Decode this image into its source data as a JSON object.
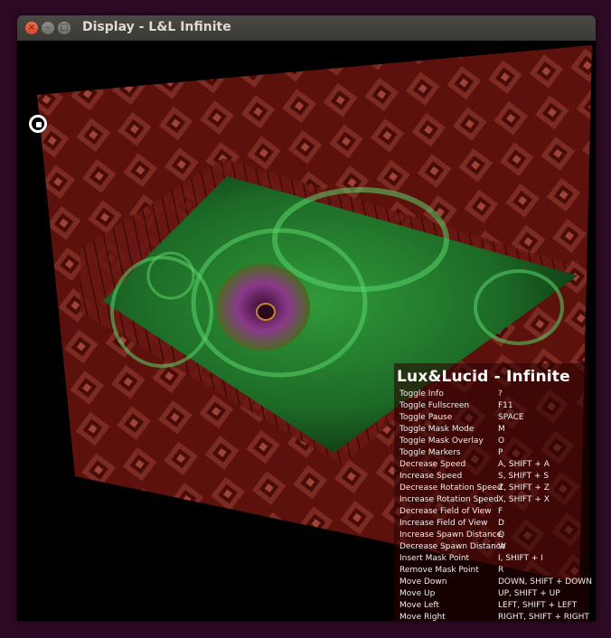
{
  "window": {
    "title": "Display - L&L Infinite",
    "close_label": "×",
    "minimize_label": "–",
    "maximize_label": "□"
  },
  "info": {
    "title": "Lux&Lucid - Infinite",
    "rows": [
      {
        "action": "Toggle Info",
        "key": "?"
      },
      {
        "action": "Toggle Fullscreen",
        "key": "F11"
      },
      {
        "action": "Toggle Pause",
        "key": "SPACE"
      },
      {
        "action": "Toggle Mask Mode",
        "key": "M"
      },
      {
        "action": "Toggle Mask Overlay",
        "key": "O"
      },
      {
        "action": "Toggle Markers",
        "key": "P"
      },
      {
        "action": "Decrease Speed",
        "key": "A, SHIFT + A"
      },
      {
        "action": "Increase Speed",
        "key": "S, SHIFT + S"
      },
      {
        "action": "Decrease Rotation Speed",
        "key": "Z, SHIFT + Z"
      },
      {
        "action": "Increase Rotation Speed",
        "key": "X, SHIFT + X"
      },
      {
        "action": "Decrease Field of View",
        "key": "F"
      },
      {
        "action": "Increase Field of View",
        "key": "D"
      },
      {
        "action": "Increase Spawn Distance",
        "key": "Q"
      },
      {
        "action": "Decrease Spawn Distance",
        "key": "W"
      },
      {
        "action": "Insert Mask Point",
        "key": "I, SHIFT + I"
      },
      {
        "action": "Remove Mask Point",
        "key": "R"
      },
      {
        "action": "Move Down",
        "key": "DOWN, SHIFT + DOWN"
      },
      {
        "action": "Move Up",
        "key": "UP, SHIFT + UP"
      },
      {
        "action": "Move Left",
        "key": "LEFT, SHIFT + LEFT"
      },
      {
        "action": "Move Right",
        "key": "RIGHT, SHIFT + RIGHT"
      }
    ]
  },
  "colors": {
    "frame_red": "#6b1410",
    "pattern_red": "#8a2a22",
    "center_green": "#1f7a2a",
    "center_purple": "#7a2a7a"
  }
}
